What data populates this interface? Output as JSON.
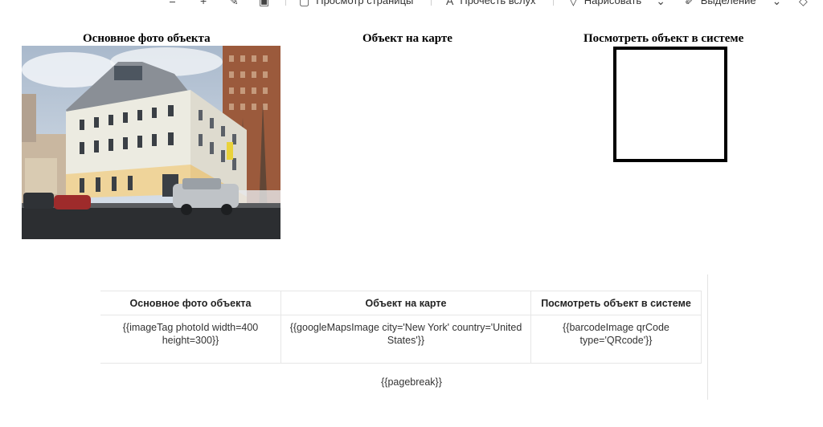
{
  "toolbar": {
    "items": [
      {
        "icon": "underline-icon",
        "label": ""
      },
      {
        "icon": "plus-icon",
        "label": ""
      },
      {
        "icon": "handwriting-icon",
        "label": ""
      },
      {
        "icon": "image-icon",
        "label": ""
      },
      {
        "icon": "page-view-icon",
        "label": "Просмотр страницы"
      },
      {
        "icon": "read-aloud-icon",
        "label": "Прочесть вслух"
      },
      {
        "icon": "draw-icon",
        "label": "Нарисовать"
      },
      {
        "icon": "highlight-icon",
        "label": "Выделение"
      },
      {
        "icon": "eraser-icon",
        "label": ""
      }
    ]
  },
  "preview": {
    "photo_heading": "Основное фото объекта",
    "map_heading": "Объект на карте",
    "system_heading": "Посмотреть объект в системе"
  },
  "template_table": {
    "headers": [
      "Основное фото объекта",
      "Объект на карте",
      "Посмотреть объект в системе"
    ],
    "row": [
      "{{imageTag photoId width=400 height=300}}",
      "{{googleMapsImage city='New York' country='United States'}}",
      "{{barcodeImage qrCode type='QRcode'}}"
    ]
  },
  "pagebreak": "{{pagebreak}}"
}
